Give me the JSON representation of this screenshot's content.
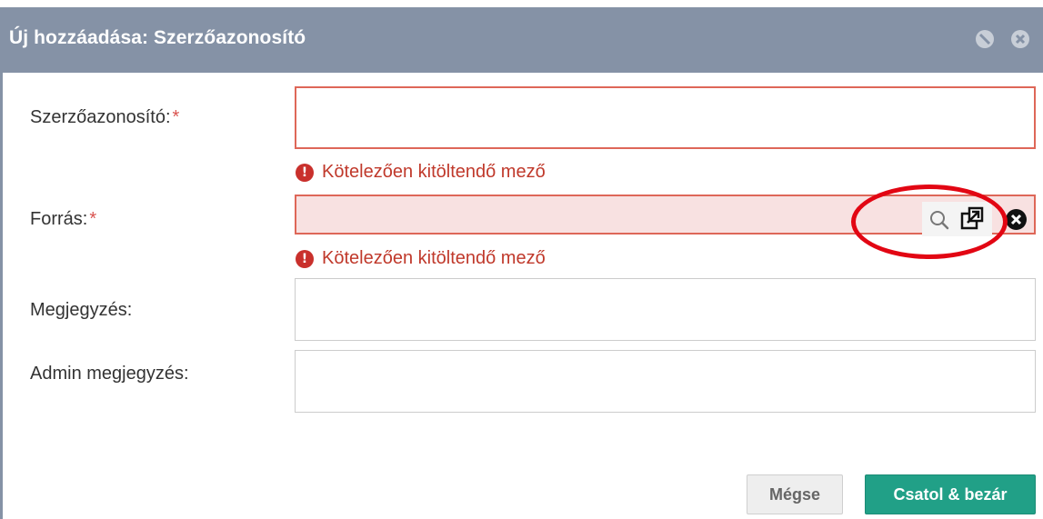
{
  "dialog": {
    "title": "Új hozzáadása: Szerzőazonosító"
  },
  "form": {
    "required_marker": "*",
    "fields": [
      {
        "label": "Szerzőazonosító:",
        "required": true,
        "value": "",
        "error": "Kötelezően kitöltendő mező"
      },
      {
        "label": "Forrás:",
        "required": true,
        "value": "",
        "error": "Kötelezően kitöltendő mező"
      },
      {
        "label": "Megjegyzés:",
        "required": false,
        "value": ""
      },
      {
        "label": "Admin megjegyzés:",
        "required": false,
        "value": ""
      }
    ],
    "error_icon": "!"
  },
  "buttons": {
    "cancel": "Mégse",
    "save_close": "Csatol & bezár"
  },
  "icons": {
    "title_minimize": "minimize-circle-icon",
    "title_close": "close-circle-icon",
    "lookup": "search-icon",
    "open": "external-link-icon",
    "clear": "clear-icon"
  },
  "colors": {
    "titlebar": "#8592a6",
    "error": "#c0392b",
    "error_border": "#de6758",
    "error_fill": "#f8e1e1",
    "primary": "#21a087",
    "annotation": "#e20613"
  }
}
